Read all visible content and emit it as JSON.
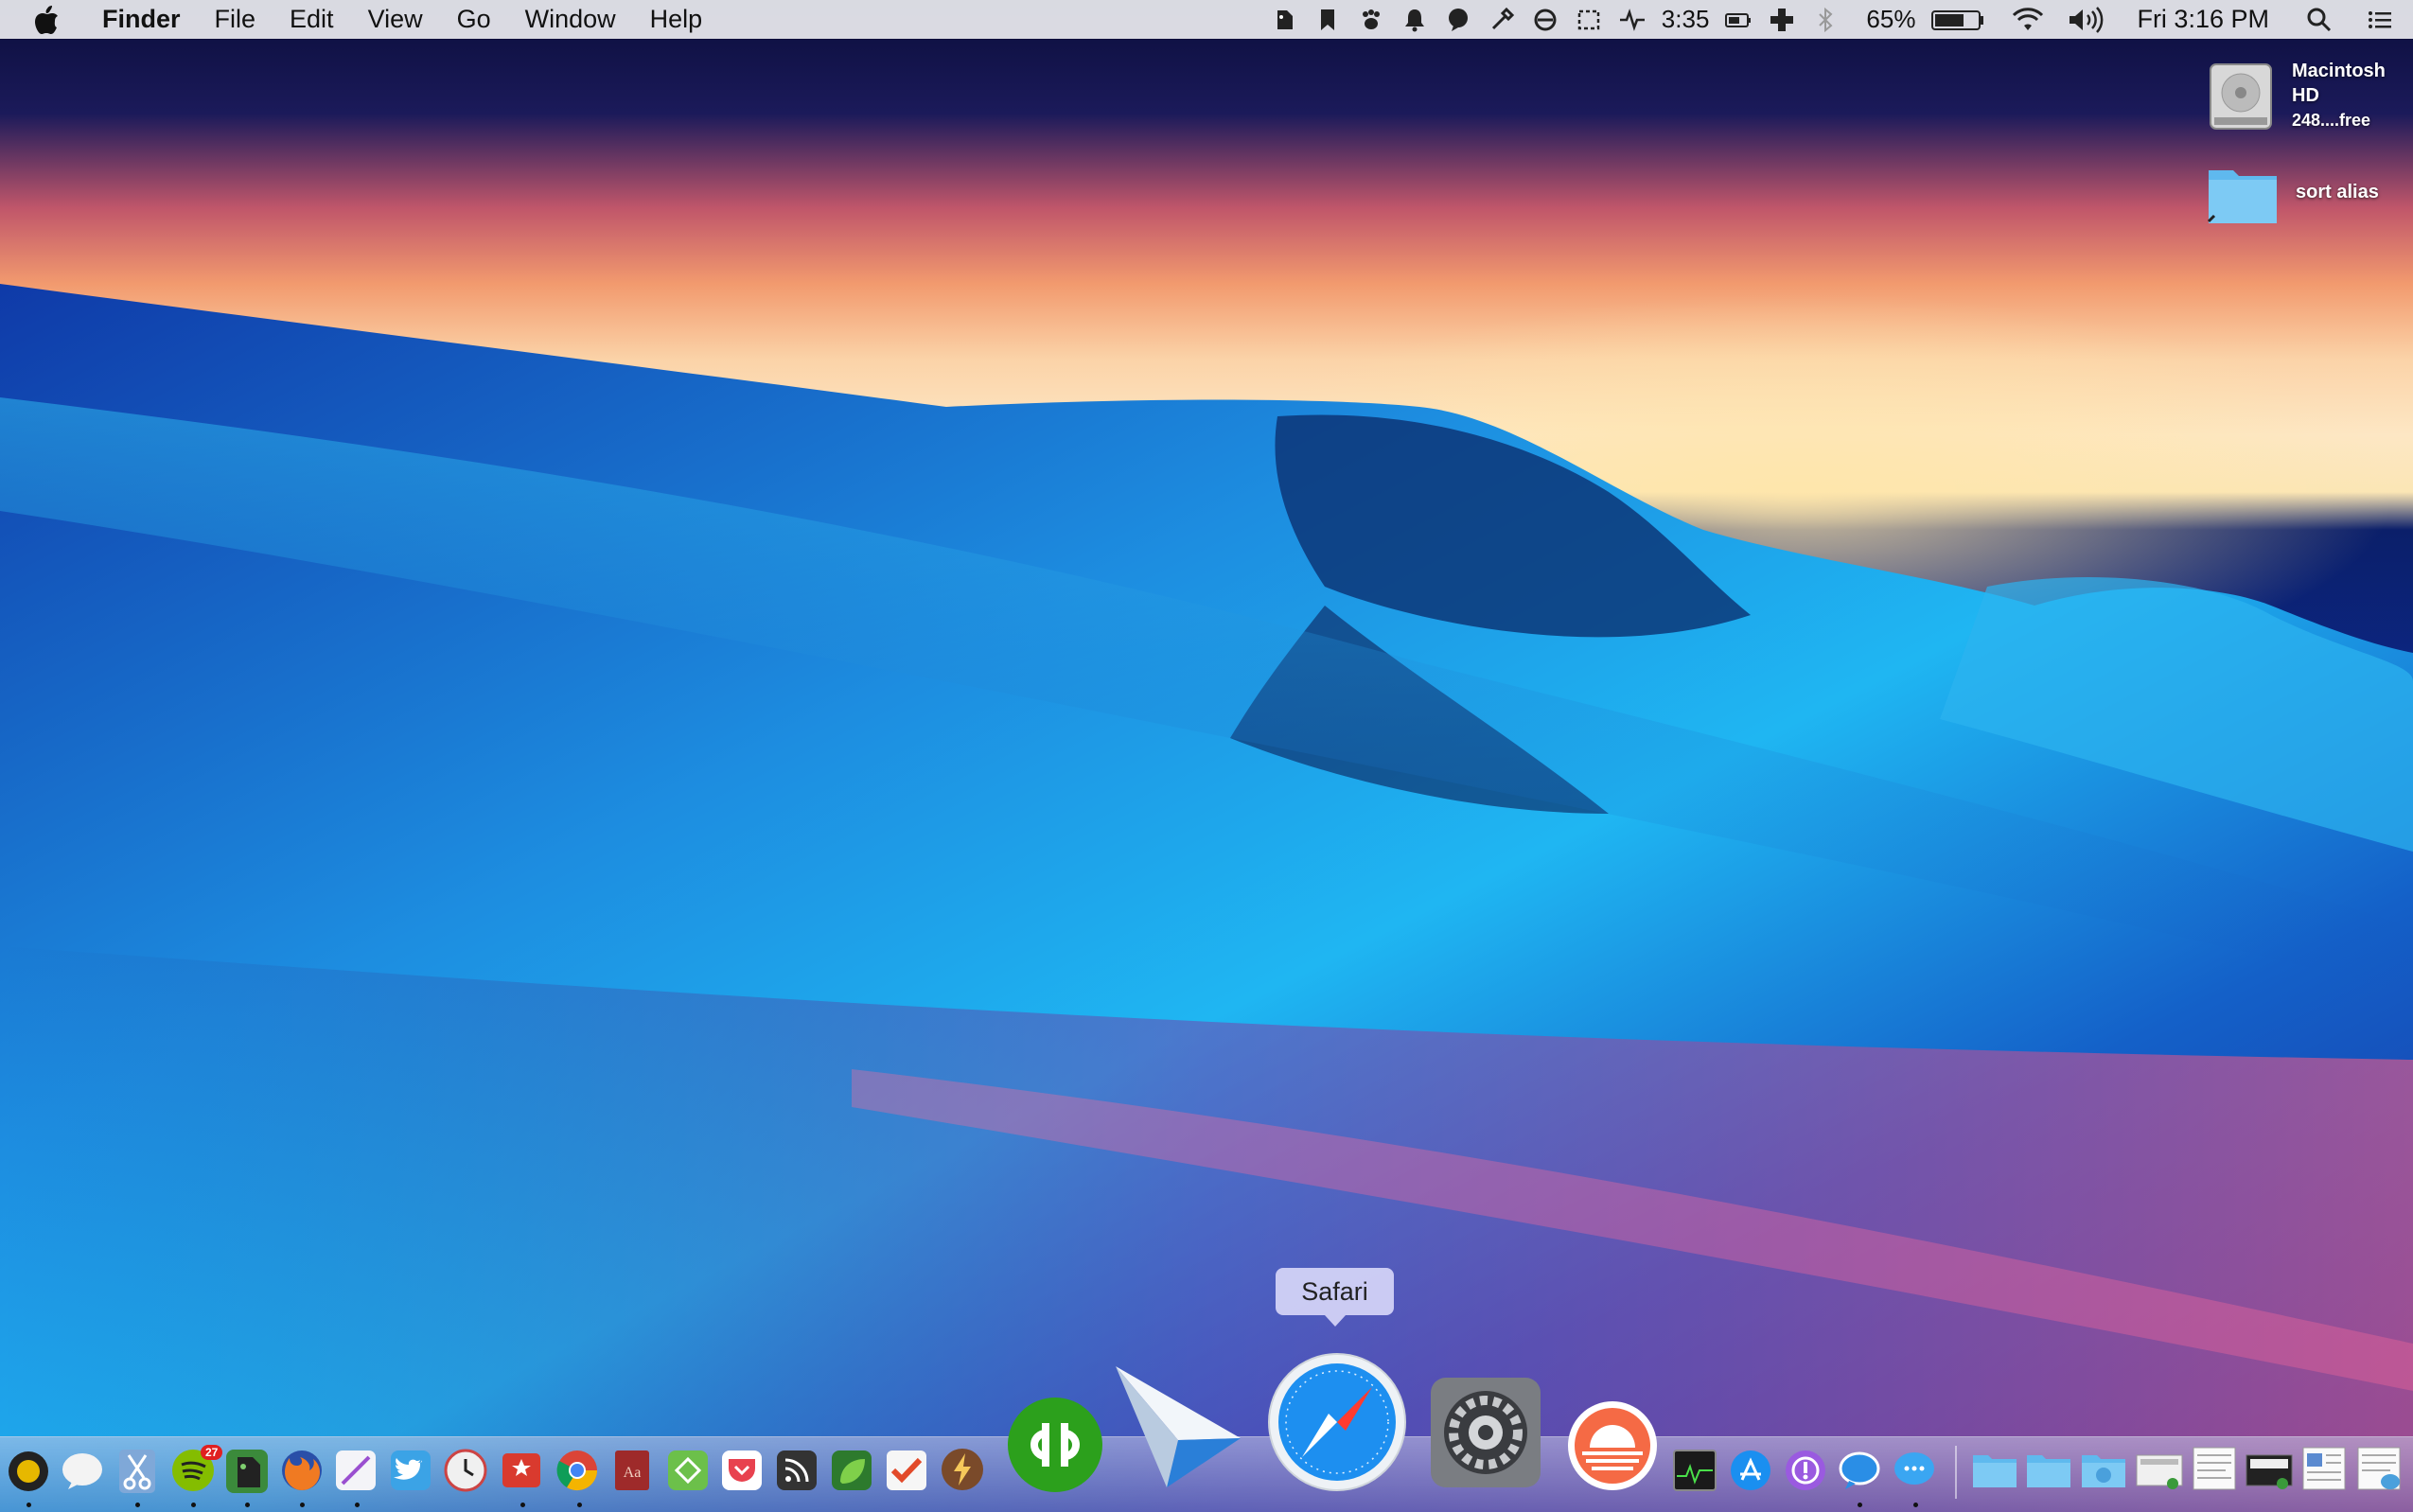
{
  "menubar": {
    "apple_icon": "apple-logo-icon",
    "app_name": "Finder",
    "menus": [
      "File",
      "Edit",
      "View",
      "Go",
      "Window",
      "Help"
    ],
    "status_icons": [
      "evernote-icon",
      "bookmark-icon",
      "paw-icon",
      "bell-icon",
      "speech-bubble-icon",
      "tools-icon",
      "circle-slash-icon",
      "selection-icon",
      "activity-icon"
    ],
    "activity_time": "3:35",
    "status_icons_2": [
      "battery-small-icon",
      "plus-icon",
      "bluetooth-icon"
    ],
    "battery_percent": "65%",
    "status_icons_3": [
      "battery-icon",
      "wifi-icon",
      "volume-icon"
    ],
    "clock": "Fri 3:16 PM",
    "spotlight_icon": "spotlight-search-icon",
    "notification_icon": "notification-center-icon"
  },
  "desktop": {
    "items": [
      {
        "name": "Macintosh HD",
        "sub": "248....free",
        "icon": "hard-drive-icon"
      },
      {
        "name": "sort alias",
        "sub": "",
        "icon": "folder-alias-icon"
      }
    ]
  },
  "dock": {
    "tooltip": "Safari",
    "spotify_badge": "27",
    "apps": [
      "dock-app-1-icon",
      "chat-bubble-icon",
      "scissors-icon",
      "spotify-icon",
      "evernote-icon",
      "firefox-icon",
      "pen-icon",
      "twitter-icon",
      "clock-icon",
      "airmail-icon",
      "chrome-icon",
      "dictionary-icon",
      "feedly-icon",
      "pocket-icon",
      "rss-icon",
      "leaf-icon",
      "checkmark-icon",
      "reeder-icon",
      "quickbooks-icon",
      "sparrow-mail-icon",
      "safari-icon",
      "system-preferences-icon",
      "sunrise-icon",
      "activity-monitor-icon",
      "app-store-icon",
      "podcast-icon",
      "messages-bubble-icon",
      "messages-icon",
      "folder-icon",
      "folder-icon",
      "downloads-icon",
      "screenshot-icon",
      "document-icon",
      "terminal-icon",
      "document-icon",
      "preview-icon"
    ]
  }
}
